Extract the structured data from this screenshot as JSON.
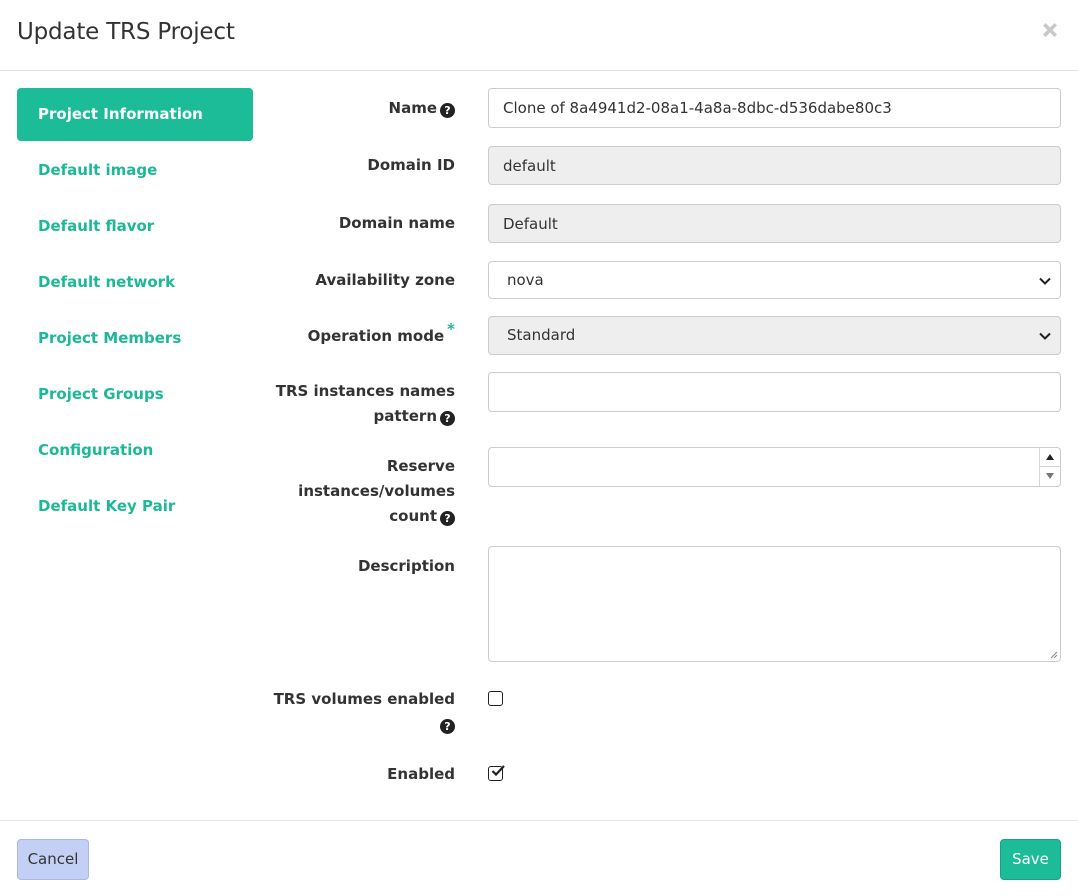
{
  "modal": {
    "title": "Update TRS Project",
    "close_icon": "close-icon"
  },
  "nav": {
    "items": [
      {
        "label": "Project Information",
        "active": true
      },
      {
        "label": "Default image",
        "active": false
      },
      {
        "label": "Default flavor",
        "active": false
      },
      {
        "label": "Default network",
        "active": false
      },
      {
        "label": "Project Members",
        "active": false
      },
      {
        "label": "Project Groups",
        "active": false
      },
      {
        "label": "Configuration",
        "active": false
      },
      {
        "label": "Default Key Pair",
        "active": false
      }
    ]
  },
  "form": {
    "name": {
      "label": "Name",
      "value": "Clone of 8a4941d2-08a1-4a8a-8dbc-d536dabe80c3"
    },
    "domain_id": {
      "label": "Domain ID",
      "value": "default"
    },
    "domain_name": {
      "label": "Domain name",
      "value": "Default"
    },
    "availability_zone": {
      "label": "Availability zone",
      "value": "nova"
    },
    "operation_mode": {
      "label": "Operation mode",
      "required_mark": "*",
      "value": "Standard"
    },
    "instances_pattern": {
      "label_line1": "TRS instances names",
      "label_line2": "pattern",
      "value": ""
    },
    "reserve_count": {
      "label_line1": "Reserve",
      "label_line2": "instances/volumes",
      "label_line3": "count",
      "value": ""
    },
    "description": {
      "label": "Description",
      "value": ""
    },
    "volumes_enabled": {
      "label": "TRS volumes enabled",
      "checked": false
    },
    "enabled": {
      "label": "Enabled",
      "checked": true
    }
  },
  "help_glyph": "?",
  "footer": {
    "cancel_label": "Cancel",
    "save_label": "Save"
  },
  "colors": {
    "accent": "#1dbc98",
    "cancel_bg": "#c3cff5",
    "disabled_bg": "#eeeeee"
  }
}
